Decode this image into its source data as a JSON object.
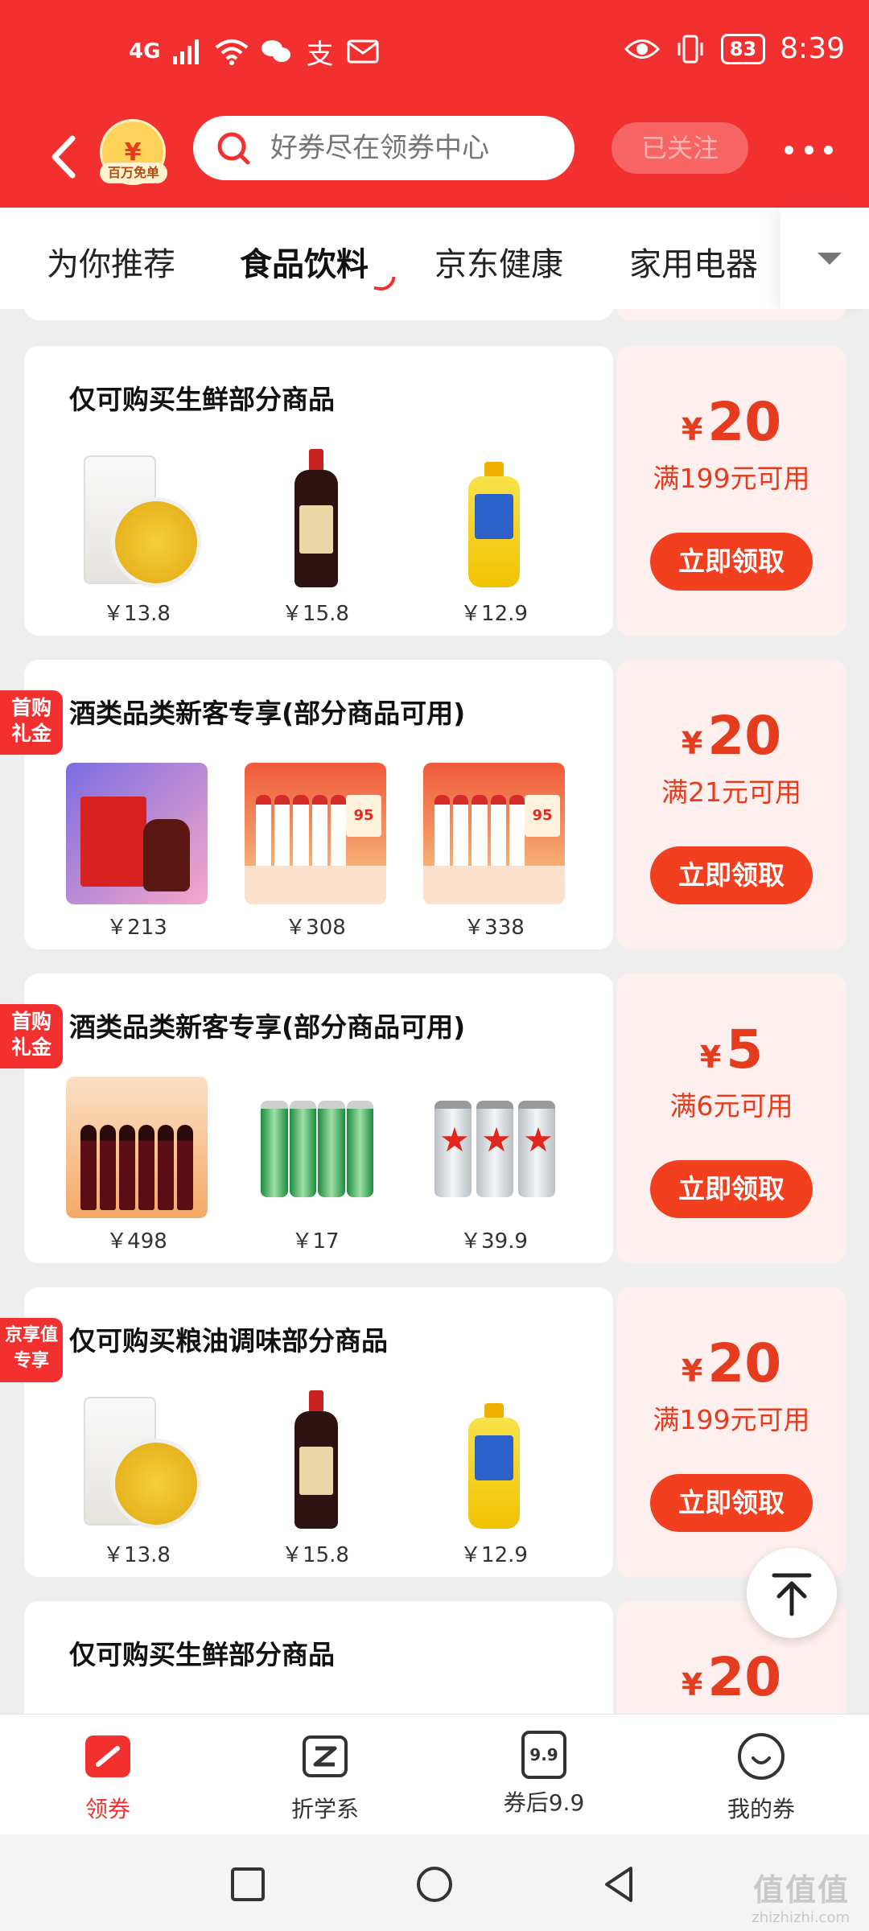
{
  "status_bar": {
    "network": "4G",
    "battery": "83",
    "time": "8:39"
  },
  "header": {
    "badge_label": "百万免单",
    "search_placeholder": "好券尽在领券中心",
    "follow_label": "已关注"
  },
  "tabs": {
    "items": [
      "为你推荐",
      "食品饮料",
      "京东健康",
      "家用电器"
    ],
    "active_index": 1
  },
  "coupons": [
    {
      "title": "仅可购买生鲜部分商品",
      "tag": "",
      "products": [
        {
          "price": "￥13.8"
        },
        {
          "price": "￥15.8"
        },
        {
          "price": "￥12.9"
        }
      ],
      "currency": "¥",
      "amount": "20",
      "condition": "满199元可用",
      "action": "立即领取"
    },
    {
      "title": "酒类品类新客专享(部分商品可用)",
      "tag": "首购礼金",
      "tag_line1": "首购",
      "tag_line2": "礼金",
      "products": [
        {
          "price": "￥213"
        },
        {
          "price": "￥308"
        },
        {
          "price": "￥338"
        }
      ],
      "currency": "¥",
      "amount": "20",
      "condition": "满21元可用",
      "action": "立即领取"
    },
    {
      "title": "酒类品类新客专享(部分商品可用)",
      "tag": "首购礼金",
      "tag_line1": "首购",
      "tag_line2": "礼金",
      "products": [
        {
          "price": "￥498"
        },
        {
          "price": "￥17"
        },
        {
          "price": "￥39.9"
        }
      ],
      "currency": "¥",
      "amount": "5",
      "condition": "满6元可用",
      "action": "立即领取"
    },
    {
      "title": "仅可购买粮油调味部分商品",
      "tag": "京享值专享",
      "tag_line1": "京享值",
      "tag_line2": "专享",
      "products": [
        {
          "price": "￥13.8"
        },
        {
          "price": "￥15.8"
        },
        {
          "price": "￥12.9"
        }
      ],
      "currency": "¥",
      "amount": "20",
      "condition": "满199元可用",
      "action": "立即领取"
    },
    {
      "title": "仅可购买生鲜部分商品",
      "tag": "",
      "currency": "¥",
      "amount": "20"
    }
  ],
  "bottom_nav": {
    "items": [
      {
        "label": "领券",
        "icon": "coupon-icon"
      },
      {
        "label": "折学系",
        "icon": "z-logo-icon"
      },
      {
        "label": "券后9.9",
        "icon": "price-tag-icon",
        "icon_text": "9.9"
      },
      {
        "label": "我的券",
        "icon": "smile-icon"
      }
    ],
    "active_index": 0
  },
  "watermark": {
    "line1": "值值值",
    "line2": "zhizhizhi.com"
  },
  "colors": {
    "brand_red": "#f23030",
    "coupon_red": "#e53b1e",
    "button_red": "#f13f1f"
  }
}
